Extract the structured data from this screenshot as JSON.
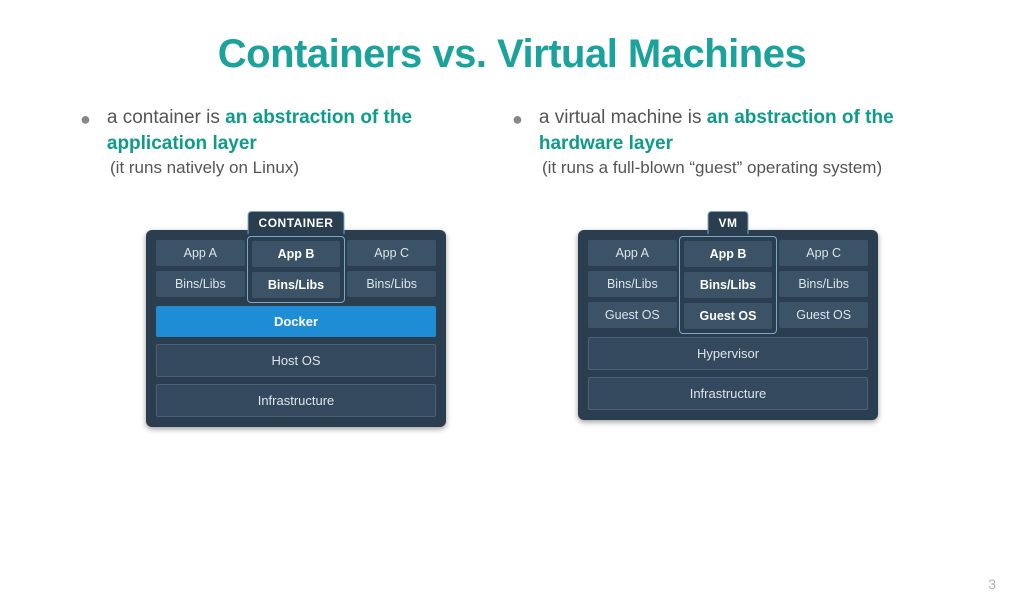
{
  "title": "Containers vs. Virtual Machines",
  "page_number": "3",
  "left": {
    "bullet_pre": "a container is ",
    "bullet_em": "an abstraction of the application layer",
    "sub": "(it runs natively on Linux)",
    "diagram": {
      "label": "CONTAINER",
      "apps": [
        "App A",
        "App B",
        "App C"
      ],
      "bins": [
        "Bins/Libs",
        "Bins/Libs",
        "Bins/Libs"
      ],
      "engine": "Docker",
      "os": "Host OS",
      "infra": "Infrastructure"
    }
  },
  "right": {
    "bullet_pre": "a virtual machine is ",
    "bullet_em": "an abstraction of the hardware layer",
    "sub": "(it runs a full-blown “guest” operating system)",
    "diagram": {
      "label": "VM",
      "apps": [
        "App A",
        "App B",
        "App C"
      ],
      "bins": [
        "Bins/Libs",
        "Bins/Libs",
        "Bins/Libs"
      ],
      "guest": [
        "Guest OS",
        "Guest OS",
        "Guest OS"
      ],
      "engine": "Hypervisor",
      "infra": "Infrastructure"
    }
  }
}
